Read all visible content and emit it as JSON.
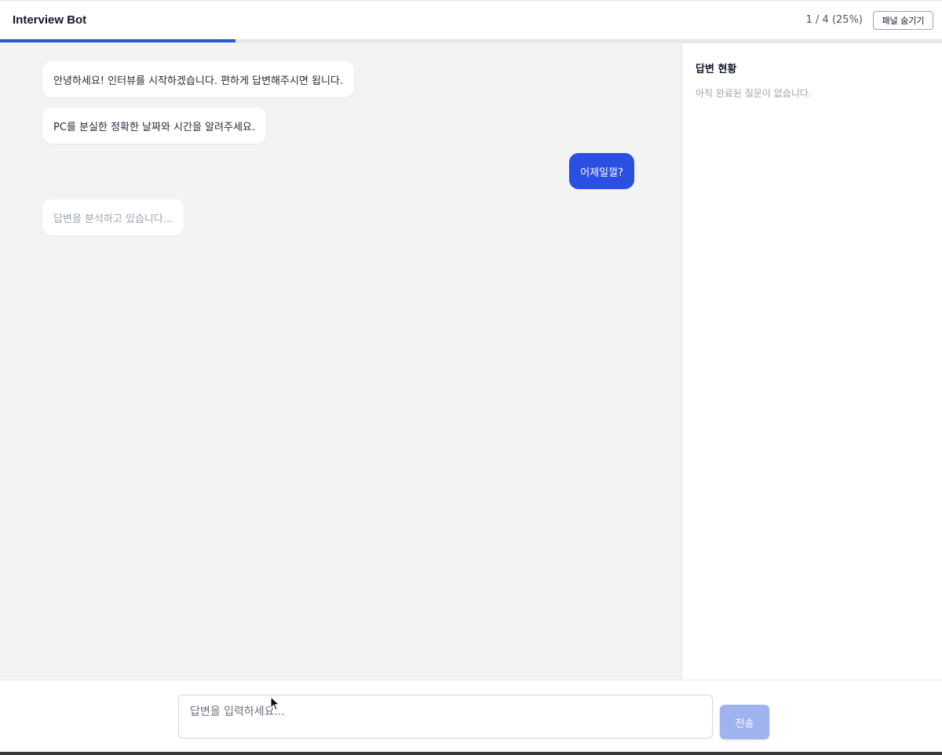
{
  "header": {
    "title": "Interview Bot",
    "progress_text": "1 / 4 (25%)",
    "progress_fraction": 0.25,
    "toggle_panel_label": "패널 숨기기",
    "accent_color": "#2e55d4"
  },
  "chat": {
    "messages": [
      {
        "role": "bot",
        "text": "안녕하세요! 인터뷰를 시작하겠습니다. 편하게 답변해주시면 됩니다."
      },
      {
        "role": "bot",
        "text": "PC를 분실한 정확한 날짜와 시간을 알려주세요."
      },
      {
        "role": "user",
        "text": "어제일껄?"
      },
      {
        "role": "bot",
        "text": "답변을 분석하고 있습니다..."
      }
    ]
  },
  "panel": {
    "title": "답변 현황",
    "empty_text": "아직 완료된 질문이 없습니다."
  },
  "input": {
    "placeholder": "답변을 입력하세요...",
    "send_label": "전송"
  },
  "icons": {
    "cursor": "mouse-pointer-icon"
  }
}
